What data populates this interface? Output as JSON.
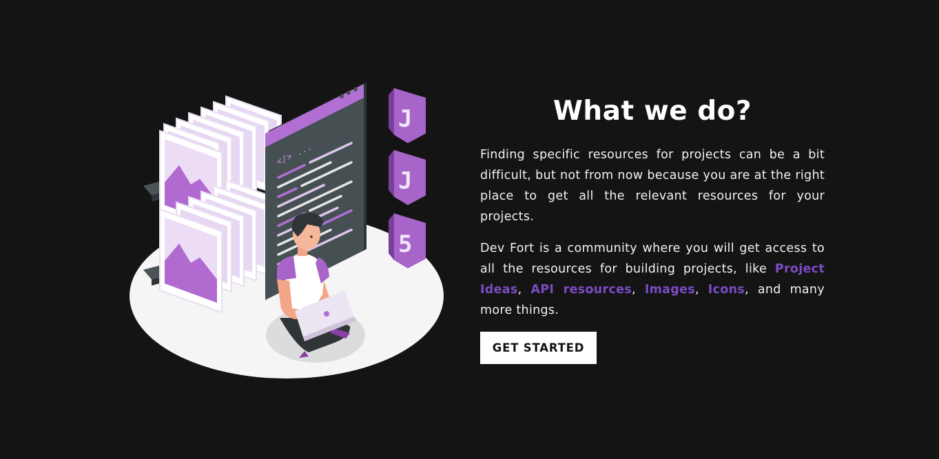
{
  "section": {
    "heading": "What we do?",
    "paragraph1": "Finding specific resources for projects can be a bit difficult, but not from now because you are at the right place to get all the relevant resources for your projects.",
    "paragraph2": {
      "intro": "Dev Fort is a community where you will get access to all the resources for building projects, like ",
      "links": [
        "Project Ideas",
        "API resources",
        "Images",
        "Icons"
      ],
      "separator": ", ",
      "and_text": ", and",
      "outro": " many more things."
    },
    "cta_label": "GET STARTED"
  },
  "illustration": {
    "code_badge": "</> ...",
    "badge_letters": [
      "J",
      "J",
      "5"
    ]
  },
  "colors": {
    "background": "#141414",
    "accent_purple": "#a865c9",
    "link_purple": "#7c4bc4",
    "text": "#ffffff",
    "button_bg": "#ffffff"
  }
}
